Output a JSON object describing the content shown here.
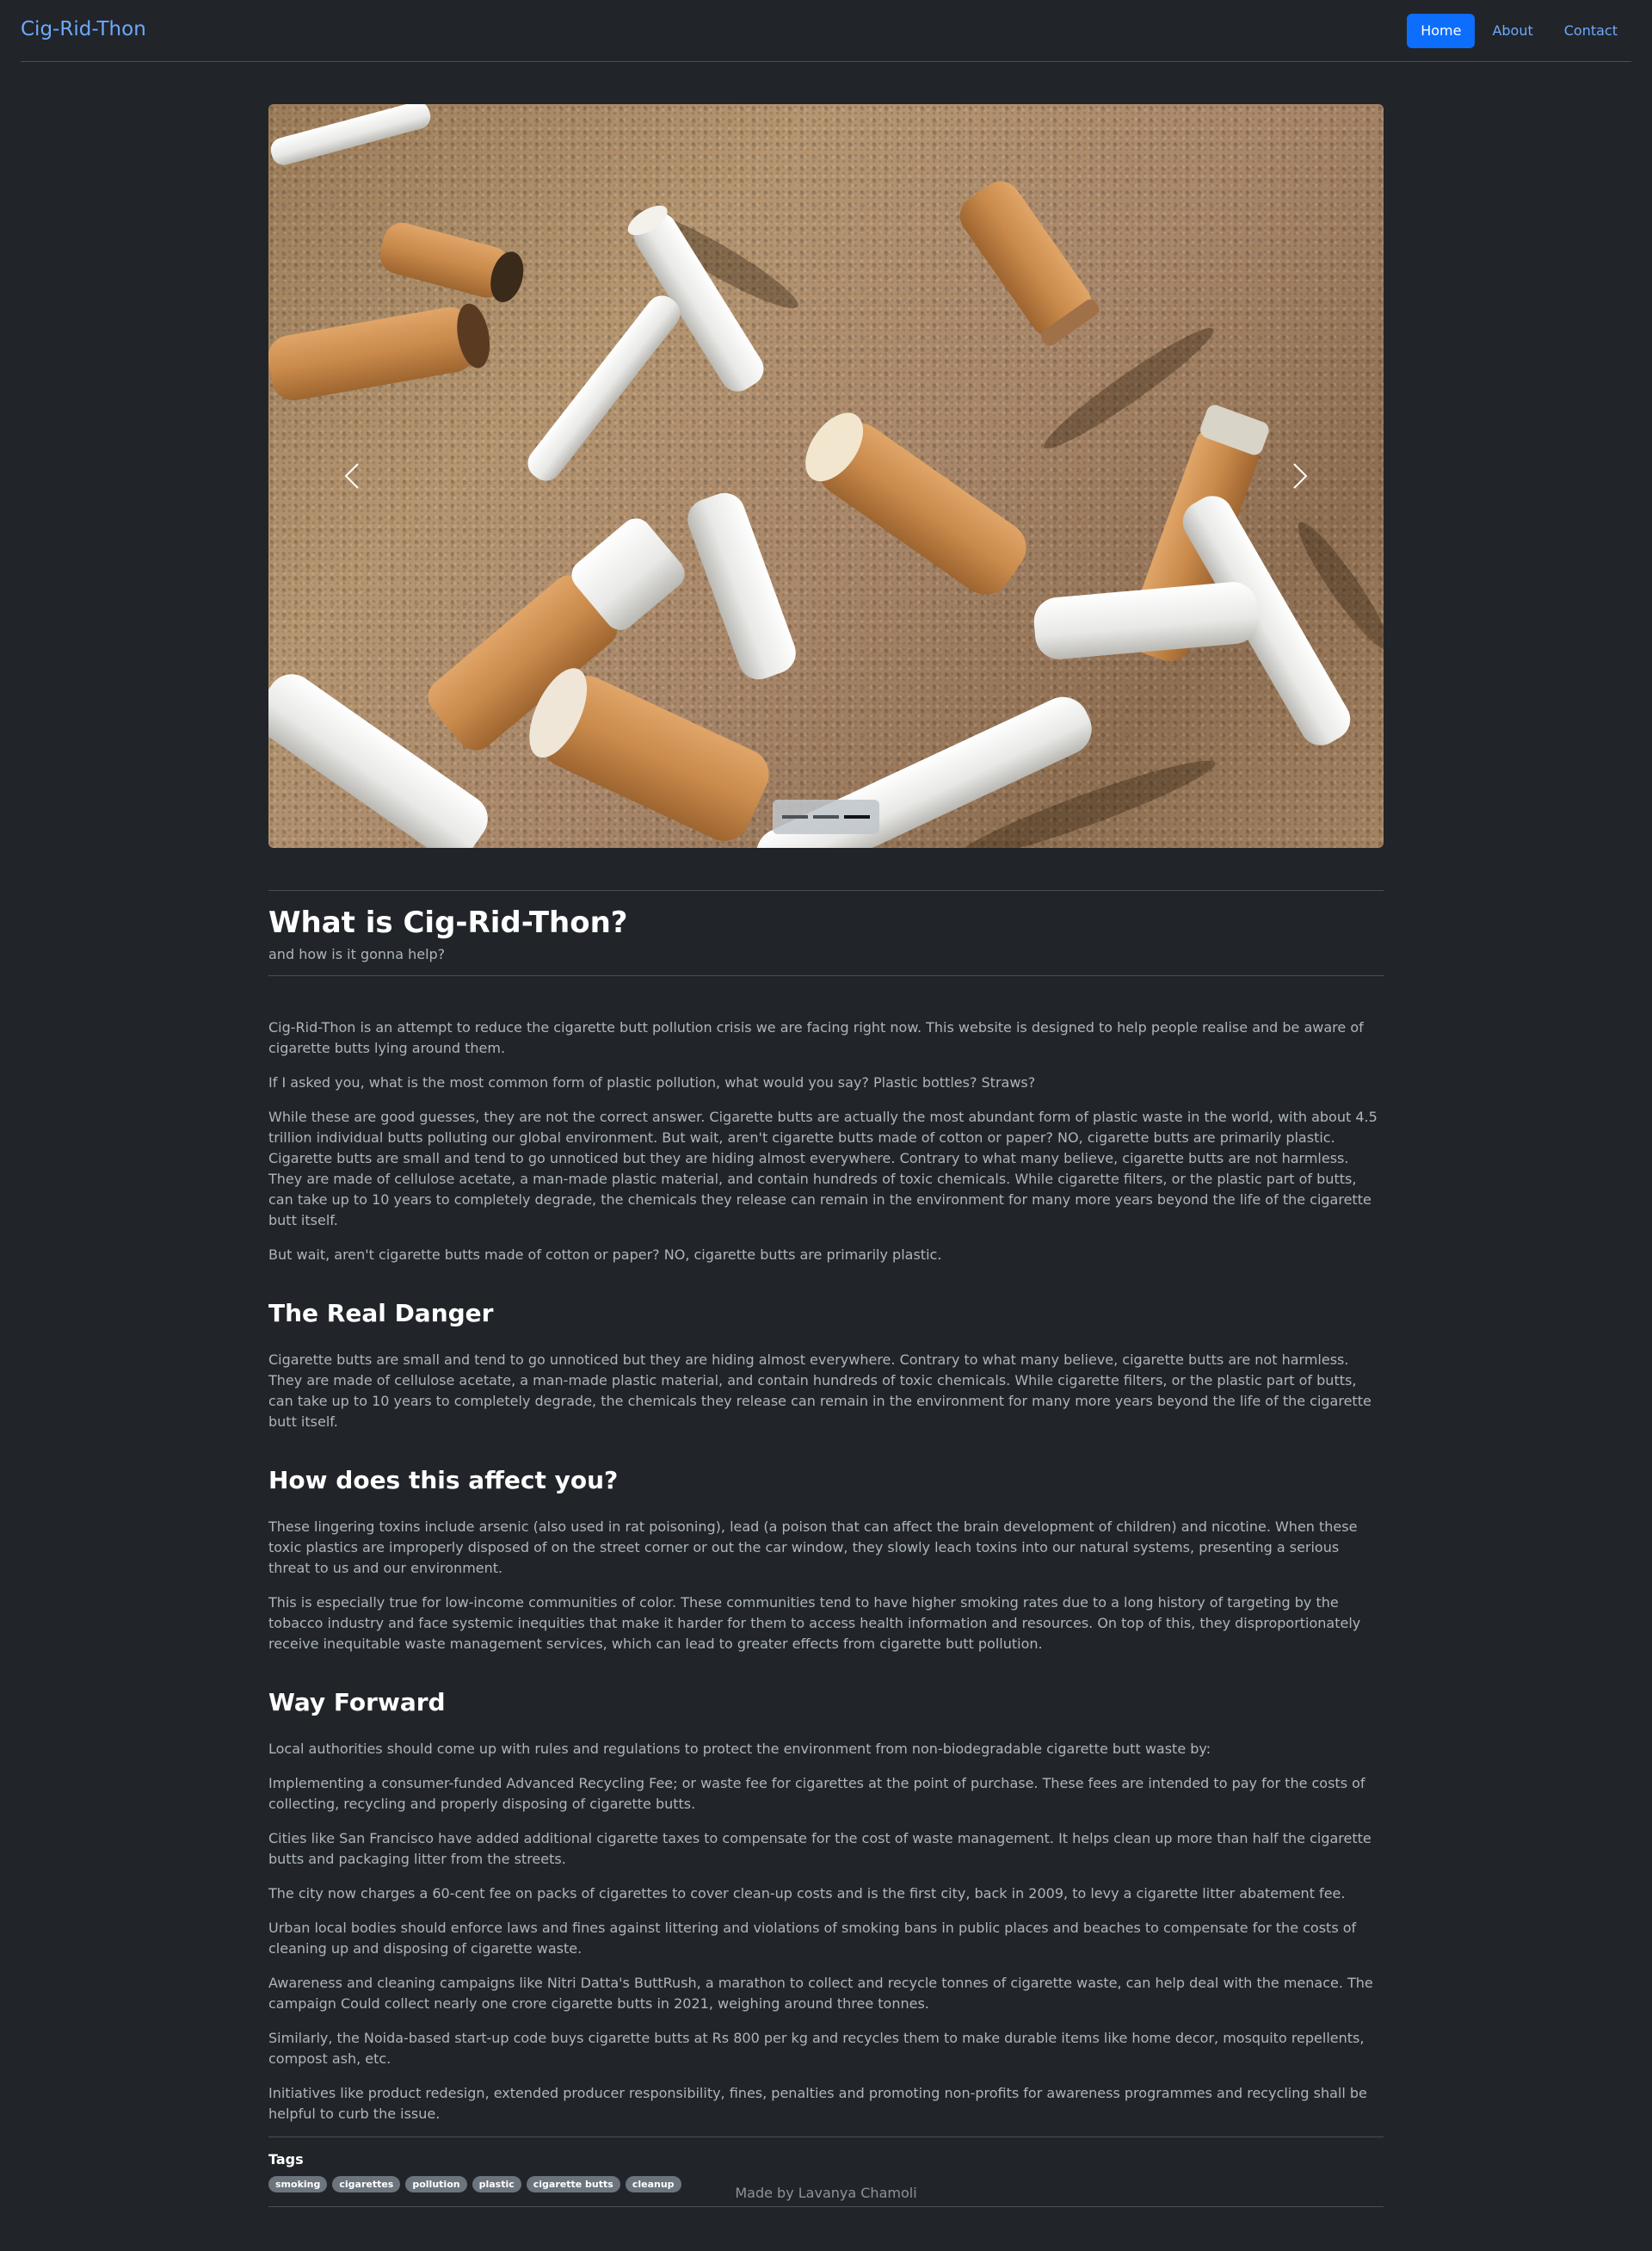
{
  "nav": {
    "brand": "Cig-Rid-Thon",
    "links": [
      "Home",
      "About",
      "Contact"
    ]
  },
  "carousel": {
    "image": "cigarette-butts-on-sand",
    "active_slide": 3,
    "slide_count": 3
  },
  "hero": {
    "title": "What is Cig-Rid-Thon?",
    "subtitle": "and how is it gonna help?"
  },
  "intro": {
    "paragraphs": [
      "Cig-Rid-Thon is an attempt to reduce the cigarette butt pollution crisis we are facing right now. This website is designed to help people realise and be aware of cigarette butts lying around them.",
      "If I asked you, what is the most common form of plastic pollution, what would you say? Plastic bottles? Straws?",
      "While these are good guesses, they are not the correct answer. Cigarette butts are actually the most abundant form of plastic waste in the world, with about 4.5 trillion individual butts polluting our global environment. But wait, aren't cigarette butts made of cotton or paper? NO, cigarette butts are primarily plastic. Cigarette butts are small and tend to go unnoticed but they are hiding almost everywhere. Contrary to what many believe, cigarette butts are not harmless. They are made of cellulose acetate, a man-made plastic material, and contain hundreds of toxic chemicals. While cigarette filters, or the plastic part of butts, can take up to 10 years to completely degrade, the chemicals they release can remain in the environment for many more years beyond the life of the cigarette butt itself.",
      "But wait, aren't cigarette butts made of cotton or paper? NO, cigarette butts are primarily plastic."
    ]
  },
  "danger": {
    "heading": "The Real Danger",
    "paragraphs": [
      "Cigarette butts are small and tend to go unnoticed but they are hiding almost everywhere. Contrary to what many believe, cigarette butts are not harmless. They are made of cellulose acetate, a man-made plastic material, and contain hundreds of toxic chemicals. While cigarette filters, or the plastic part of butts, can take up to 10 years to completely degrade, the chemicals they release can remain in the environment for many more years beyond the life of the cigarette butt itself."
    ]
  },
  "affect": {
    "heading": "How does this affect you?",
    "paragraphs": [
      "These lingering toxins include arsenic (also used in rat poisoning), lead (a poison that can affect the brain development of children) and nicotine. When these toxic plastics are improperly disposed of on the street corner or out the car window, they slowly leach toxins into our natural systems, presenting a serious threat to us and our environment.",
      "This is especially true for low-income communities of color. These communities tend to have higher smoking rates due to a long history of targeting by the tobacco industry and face systemic inequities that make it harder for them to access health information and resources. On top of this, they disproportionately receive inequitable waste management services, which can lead to greater effects from cigarette butt pollution."
    ]
  },
  "forward": {
    "heading": "Way Forward",
    "paragraphs": [
      "Local authorities should come up with rules and regulations to protect the environment from non-biodegradable cigarette butt waste by:",
      "Implementing a consumer-funded Advanced Recycling Fee; or waste fee for cigarettes at the point of purchase. These fees are intended to pay for the costs of collecting, recycling and properly disposing of cigarette butts.",
      "Cities like San Francisco have added additional cigarette taxes to compensate for the cost of waste management. It helps clean up more than half the cigarette butts and packaging litter from the streets.",
      "The city now charges a 60-cent fee on packs of cigarettes to cover clean-up costs and is the first city, back in 2009, to levy a cigarette litter abatement fee.",
      "Urban local bodies should enforce laws and fines against littering and violations of smoking bans in public places and beaches to compensate for the costs of cleaning up and disposing of cigarette waste.",
      "Awareness and cleaning campaigns like Nitri Datta's ButtRush, a marathon to collect and recycle tonnes of cigarette waste, can help deal with the menace. The campaign Could collect nearly one crore cigarette butts in 2021, weighing around three tonnes.",
      "Similarly, the Noida-based start-up code buys cigarette butts at Rs 800 per kg and recycles them to make durable items like home decor, mosquito repellents, compost ash, etc.",
      "Initiatives like product redesign, extended producer responsibility, fines, penalties and promoting non-profits for awareness programmes and recycling shall be helpful to curb the issue."
    ]
  },
  "tags": {
    "title": "Tags",
    "items": [
      "smoking",
      "cigarettes",
      "pollution",
      "plastic",
      "cigarette butts",
      "cleanup"
    ]
  },
  "footer": {
    "text": "Made by Lavanya Chamoli"
  },
  "colors": {
    "background": "#212529",
    "accent": "#0d6efd",
    "link": "#6ea8fe",
    "text": "#adb5bd",
    "heading": "#ffffff"
  }
}
